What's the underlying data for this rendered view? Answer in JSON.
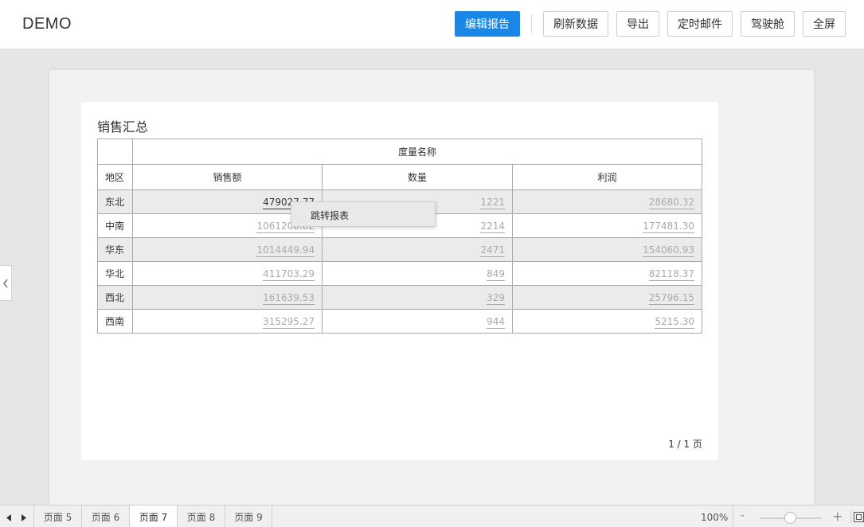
{
  "header": {
    "title": "DEMO",
    "buttons": {
      "edit_report": "编辑报告",
      "refresh_data": "刷新数据",
      "export": "导出",
      "scheduled_mail": "定时邮件",
      "cockpit": "驾驶舱",
      "fullscreen": "全屏"
    },
    "accent_color": "#1a86e5"
  },
  "report": {
    "title": "销售汇总",
    "measure_header": "度量名称",
    "columns": {
      "region": "地区",
      "sales": "销售额",
      "quantity": "数量",
      "profit": "利润"
    },
    "rows": [
      {
        "region": "东北",
        "sales": "479027.77",
        "quantity": "1221",
        "profit": "28680.32"
      },
      {
        "region": "中南",
        "sales": "1061206.82",
        "quantity": "2214",
        "profit": "177481.30"
      },
      {
        "region": "华东",
        "sales": "1014449.94",
        "quantity": "2471",
        "profit": "154060.93"
      },
      {
        "region": "华北",
        "sales": "411703.29",
        "quantity": "849",
        "profit": "82118.37"
      },
      {
        "region": "西北",
        "sales": "161639.53",
        "quantity": "329",
        "profit": "25796.15"
      },
      {
        "region": "西南",
        "sales": "315295.27",
        "quantity": "944",
        "profit": "5215.30"
      }
    ],
    "page_indicator": "1 / 1 页"
  },
  "context_menu": {
    "item": "跳转报表"
  },
  "bottom_bar": {
    "tabs": [
      "页面 5",
      "页面 6",
      "页面 7",
      "页面 8",
      "页面 9"
    ],
    "active_tab": "页面 7",
    "zoom": "100%",
    "zoom_minus": "-",
    "zoom_plus": "+"
  }
}
